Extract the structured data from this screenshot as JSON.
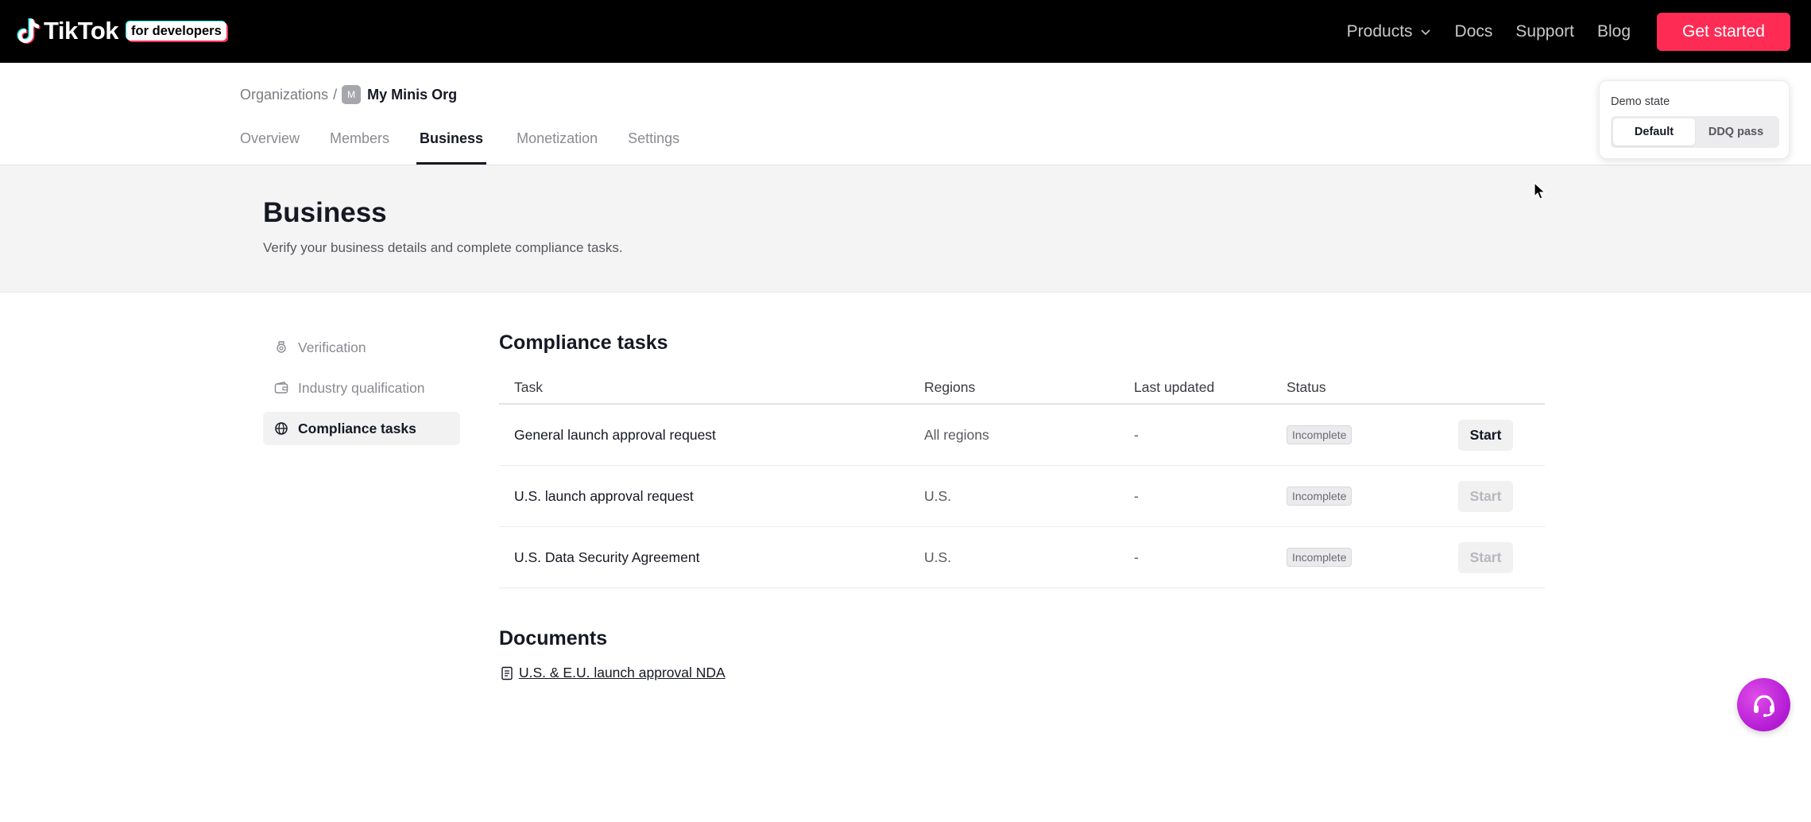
{
  "navbar": {
    "logo_text": "TikTok",
    "logo_badge": "for developers",
    "links": [
      "Products",
      "Docs",
      "Support",
      "Blog"
    ],
    "cta": "Get started"
  },
  "org": {
    "breadcrumb_root": "Organizations",
    "breadcrumb_sep": "/",
    "avatar_letter": "M",
    "name": "My Minis Org",
    "tabs": [
      "Overview",
      "Members",
      "Business",
      "Monetization",
      "Settings"
    ],
    "active_tab": "Business"
  },
  "hero": {
    "title": "Business",
    "subtitle": "Verify your business details and complete compliance tasks."
  },
  "side_menu": [
    {
      "label": "Verification",
      "icon": "badge-icon"
    },
    {
      "label": "Industry qualification",
      "icon": "wallet-icon"
    },
    {
      "label": "Compliance tasks",
      "icon": "globe-icon",
      "active": true
    }
  ],
  "compliance": {
    "title": "Compliance tasks",
    "headers": [
      "Task",
      "Regions",
      "Last updated",
      "Status"
    ],
    "rows": [
      {
        "task": "General launch approval request",
        "region": "All regions",
        "updated": "-",
        "status": "Incomplete",
        "action": "Start"
      },
      {
        "task": "U.S. launch approval request",
        "region": "U.S.",
        "updated": "-",
        "status": "Incomplete",
        "action": "Start"
      },
      {
        "task": "U.S. Data Security Agreement",
        "region": "U.S.",
        "updated": "-",
        "status": "Incomplete",
        "action": "Start"
      }
    ]
  },
  "documents": {
    "title": "Documents",
    "items": [
      "U.S. & E.U. launch approval NDA"
    ]
  },
  "demo_state": {
    "label": "Demo state",
    "options": [
      "Default",
      "DDQ pass"
    ],
    "selected": "Default"
  },
  "colors": {
    "brand_pink": "#fe2c55",
    "navbar_bg": "#000000",
    "hero_bg": "#f4f4f5",
    "fab_purple": "#c52ad9"
  }
}
